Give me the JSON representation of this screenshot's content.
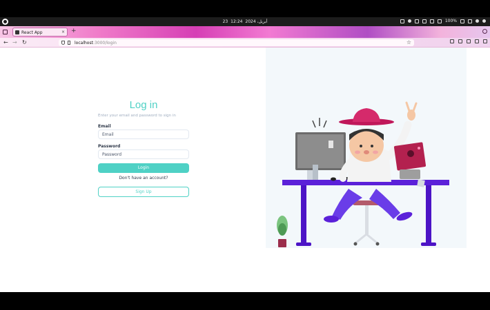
{
  "os": {
    "clock": {
      "date": "23 أبريل، 2024",
      "time": "12:24"
    },
    "battery": "100%"
  },
  "browser": {
    "tab_title": "React App",
    "tab_close": "×",
    "new_tab": "+",
    "url_host": "localhost",
    "url_path": ":3000/login",
    "back": "←",
    "forward": "→",
    "reload": "↻",
    "star": "☆"
  },
  "login": {
    "title": "Log in",
    "subtitle": "Enter your email and password to sign in",
    "email_label": "Email",
    "email_placeholder": "Email",
    "password_label": "Password",
    "password_placeholder": "Password",
    "login_button": "Login",
    "no_account": "Don't have an account?",
    "signup_button": "Sign Up"
  },
  "colors": {
    "accent": "#4fd1c5",
    "illustration_desk": "#5b21d9",
    "illustration_bg": "#f3f8fb"
  },
  "illustration": {
    "description_icon": "person-at-desk-illustration"
  }
}
